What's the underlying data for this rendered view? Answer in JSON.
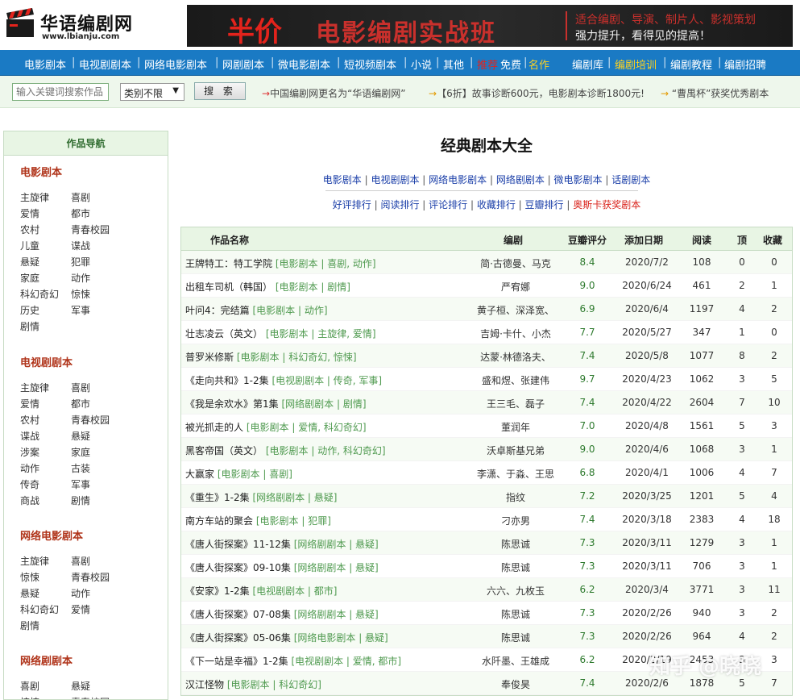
{
  "brand": {
    "title": "华语编剧网",
    "url": "www.lbianju.com"
  },
  "banner": {
    "half": "半价",
    "title": "电影编剧实战班",
    "line1": "适合编剧、导演、制片人、影视策划",
    "line2": "强力提升，看得见的提高！"
  },
  "nav": {
    "items": [
      "电影剧本",
      "电视剧剧本",
      "网络电影剧本",
      "网剧剧本",
      "微电影剧本",
      "短视频剧本",
      "小说",
      "其他"
    ],
    "recommend": "推荐",
    "free": "免费",
    "masterpiece": "名作",
    "right": [
      "编剧库",
      "编剧培训",
      "编剧教程",
      "编剧招聘"
    ]
  },
  "search": {
    "placeholder": "输入关键词搜索作品",
    "category": "类别不限",
    "button": "搜 索",
    "notice1": "中国编剧网更名为“华语编剧网”",
    "notice2": "【6折】故事诊断600元，电影剧本诊断1800元!",
    "notice3": "“曹禺杯”获奖优秀剧本"
  },
  "sidebar": {
    "heading": "作品导航",
    "sections": [
      {
        "title": "电影剧本",
        "items": [
          "主旋律",
          "喜剧",
          "爱情",
          "都市",
          "农村",
          "青春校园",
          "儿童",
          "谍战",
          "悬疑",
          "犯罪",
          "家庭",
          "动作",
          "科幻奇幻",
          "惊悚",
          "历史",
          "军事",
          "剧情"
        ]
      },
      {
        "title": "电视剧剧本",
        "items": [
          "主旋律",
          "喜剧",
          "爱情",
          "都市",
          "农村",
          "青春校园",
          "谍战",
          "悬疑",
          "涉案",
          "家庭",
          "动作",
          "古装",
          "传奇",
          "军事",
          "商战",
          "剧情"
        ]
      },
      {
        "title": "网络电影剧本",
        "items": [
          "主旋律",
          "喜剧",
          "惊悚",
          "青春校园",
          "悬疑",
          "动作",
          "科幻奇幻",
          "爱情",
          "剧情"
        ]
      },
      {
        "title": "网络剧剧本",
        "items": [
          "喜剧",
          "悬疑",
          "惊悚",
          "青春校园"
        ]
      }
    ]
  },
  "main": {
    "title": "经典剧本大全",
    "categories": [
      "电影剧本",
      "电视剧剧本",
      "网络电影剧本",
      "网络剧剧本",
      "微电影剧本",
      "话剧剧本"
    ],
    "rankings": [
      "好评排行",
      "阅读排行",
      "评论排行",
      "收藏排行",
      "豆瓣排行"
    ],
    "oscar": "奥斯卡获奖剧本"
  },
  "table": {
    "headers": {
      "name": "作品名称",
      "author": "编剧",
      "score": "豆瓣评分",
      "date": "添加日期",
      "reads": "阅读",
      "top": "顶",
      "fav": "收藏"
    },
    "rows": [
      {
        "name": "王牌特工：特工学院",
        "meta": "[电影剧本 | 喜剧, 动作]",
        "author": "简·古德曼、马克",
        "score": "8.4",
        "date": "2020/7/2",
        "reads": "108",
        "top": "0",
        "fav": "0"
      },
      {
        "name": "出租车司机（韩国）",
        "meta": "[电影剧本 | 剧情]",
        "author": "严宥娜",
        "score": "9.0",
        "date": "2020/6/24",
        "reads": "461",
        "top": "2",
        "fav": "1"
      },
      {
        "name": "叶问4：完结篇",
        "meta": "[电影剧本 | 动作]",
        "author": "黄子桓、深泽宽、",
        "score": "6.9",
        "date": "2020/6/4",
        "reads": "1197",
        "top": "4",
        "fav": "2"
      },
      {
        "name": "壮志凌云（英文）",
        "meta": "[电影剧本 | 主旋律, 爱情]",
        "author": "吉姆·卡什、小杰",
        "score": "7.7",
        "date": "2020/5/27",
        "reads": "347",
        "top": "1",
        "fav": "0"
      },
      {
        "name": "普罗米修斯",
        "meta": "[电影剧本 | 科幻奇幻, 惊悚]",
        "author": "达蒙·林德洛夫、",
        "score": "7.4",
        "date": "2020/5/8",
        "reads": "1077",
        "top": "8",
        "fav": "2"
      },
      {
        "name": "《走向共和》1-2集",
        "meta": "[电视剧剧本 | 传奇, 军事]",
        "author": "盛和煜、张建伟",
        "score": "9.7",
        "date": "2020/4/23",
        "reads": "1062",
        "top": "3",
        "fav": "5"
      },
      {
        "name": "《我是余欢水》第1集",
        "meta": "[网络剧剧本 | 剧情]",
        "author": "王三毛、磊子",
        "score": "7.4",
        "date": "2020/4/22",
        "reads": "2604",
        "top": "7",
        "fav": "10"
      },
      {
        "name": "被光抓走的人",
        "meta": "[电影剧本 | 爱情, 科幻奇幻]",
        "author": "董润年",
        "score": "7.0",
        "date": "2020/4/8",
        "reads": "1561",
        "top": "5",
        "fav": "3"
      },
      {
        "name": "黑客帝国（英文）",
        "meta": "[电影剧本 | 动作, 科幻奇幻]",
        "author": "沃卓斯基兄弟",
        "score": "9.0",
        "date": "2020/4/6",
        "reads": "1068",
        "top": "3",
        "fav": "1"
      },
      {
        "name": "大赢家",
        "meta": "[电影剧本 | 喜剧]",
        "author": "李潇、于淼、王思",
        "score": "6.8",
        "date": "2020/4/1",
        "reads": "1006",
        "top": "4",
        "fav": "7"
      },
      {
        "name": "《重生》1-2集",
        "meta": "[网络剧剧本 | 悬疑]",
        "author": "指纹",
        "score": "7.2",
        "date": "2020/3/25",
        "reads": "1201",
        "top": "5",
        "fav": "4"
      },
      {
        "name": "南方车站的聚会",
        "meta": "[电影剧本 | 犯罪]",
        "author": "刁亦男",
        "score": "7.4",
        "date": "2020/3/18",
        "reads": "2383",
        "top": "4",
        "fav": "18"
      },
      {
        "name": "《唐人街探案》11-12集",
        "meta": "[网络剧剧本 | 悬疑]",
        "author": "陈思诚",
        "score": "7.3",
        "date": "2020/3/11",
        "reads": "1279",
        "top": "3",
        "fav": "1"
      },
      {
        "name": "《唐人街探案》09-10集",
        "meta": "[网络剧剧本 | 悬疑]",
        "author": "陈思诚",
        "score": "7.3",
        "date": "2020/3/11",
        "reads": "706",
        "top": "3",
        "fav": "1"
      },
      {
        "name": "《安家》1-2集",
        "meta": "[电视剧剧本 | 都市]",
        "author": "六六、九枚玉",
        "score": "6.2",
        "date": "2020/3/4",
        "reads": "3771",
        "top": "3",
        "fav": "11"
      },
      {
        "name": "《唐人街探案》07-08集",
        "meta": "[网络剧剧本 | 悬疑]",
        "author": "陈思诚",
        "score": "7.3",
        "date": "2020/2/26",
        "reads": "940",
        "top": "3",
        "fav": "2"
      },
      {
        "name": "《唐人街探案》05-06集",
        "meta": "[网络电影剧本 | 悬疑]",
        "author": "陈思诚",
        "score": "7.3",
        "date": "2020/2/26",
        "reads": "964",
        "top": "4",
        "fav": "2"
      },
      {
        "name": "《下一站是幸福》1-2集",
        "meta": "[电视剧剧本 | 爱情, 都市]",
        "author": "水阡墨、王雄成",
        "score": "6.2",
        "date": "2020/2/19",
        "reads": "2453",
        "top": "3",
        "fav": "3"
      },
      {
        "name": "汉江怪物",
        "meta": "[电影剧本 | 科幻奇幻]",
        "author": "奉俊昊",
        "score": "7.4",
        "date": "2020/2/6",
        "reads": "1878",
        "top": "5",
        "fav": "7"
      }
    ]
  },
  "watermark": "知乎 @晓晓"
}
